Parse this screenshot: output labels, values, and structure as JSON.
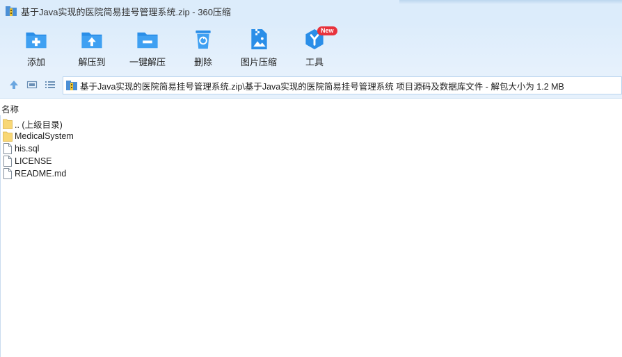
{
  "window": {
    "title": "基于Java实现的医院简易挂号管理系统.zip - 360压缩"
  },
  "toolbar": {
    "items": [
      {
        "label": "添加",
        "icon": "add-icon"
      },
      {
        "label": "解压到",
        "icon": "extract-to-icon"
      },
      {
        "label": "一键解压",
        "icon": "one-click-extract-icon"
      },
      {
        "label": "删除",
        "icon": "delete-icon"
      },
      {
        "label": "图片压缩",
        "icon": "image-compress-icon"
      },
      {
        "label": "工具",
        "icon": "tools-icon",
        "badge": "New"
      }
    ]
  },
  "address": {
    "path": "基于Java实现的医院简易挂号管理系统.zip\\基于Java实现的医院简易挂号管理系统 项目源码及数据库文件 - 解包大小为 1.2 MB"
  },
  "list": {
    "column_name": "名称",
    "files": [
      {
        "name": ".. (上级目录)",
        "type": "folder"
      },
      {
        "name": "MedicalSystem",
        "type": "folder"
      },
      {
        "name": "his.sql",
        "type": "file"
      },
      {
        "name": "LICENSE",
        "type": "file"
      },
      {
        "name": "README.md",
        "type": "file"
      }
    ]
  },
  "colors": {
    "accent": "#2a8ee8",
    "badge": "#e8323c",
    "titlebar_bg": "#dcecfb"
  }
}
